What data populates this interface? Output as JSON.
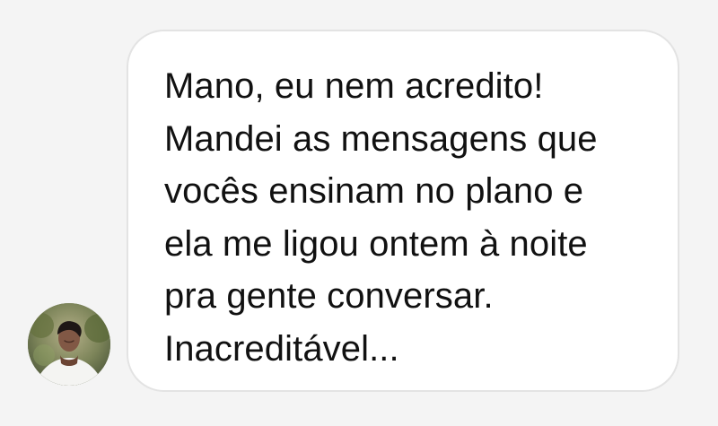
{
  "chat": {
    "message": {
      "text": "Mano, eu nem acredito!\nMandei as mensagens que\nvocês ensinam no plano e\nela me ligou ontem à noite\npra gente conversar.\nInacreditável..."
    },
    "sender": {
      "avatar_icon": "user-avatar-photo"
    }
  },
  "colors": {
    "background": "#f4f4f4",
    "bubble_background": "#ffffff",
    "bubble_border": "#e3e3e3",
    "text": "#111111"
  }
}
